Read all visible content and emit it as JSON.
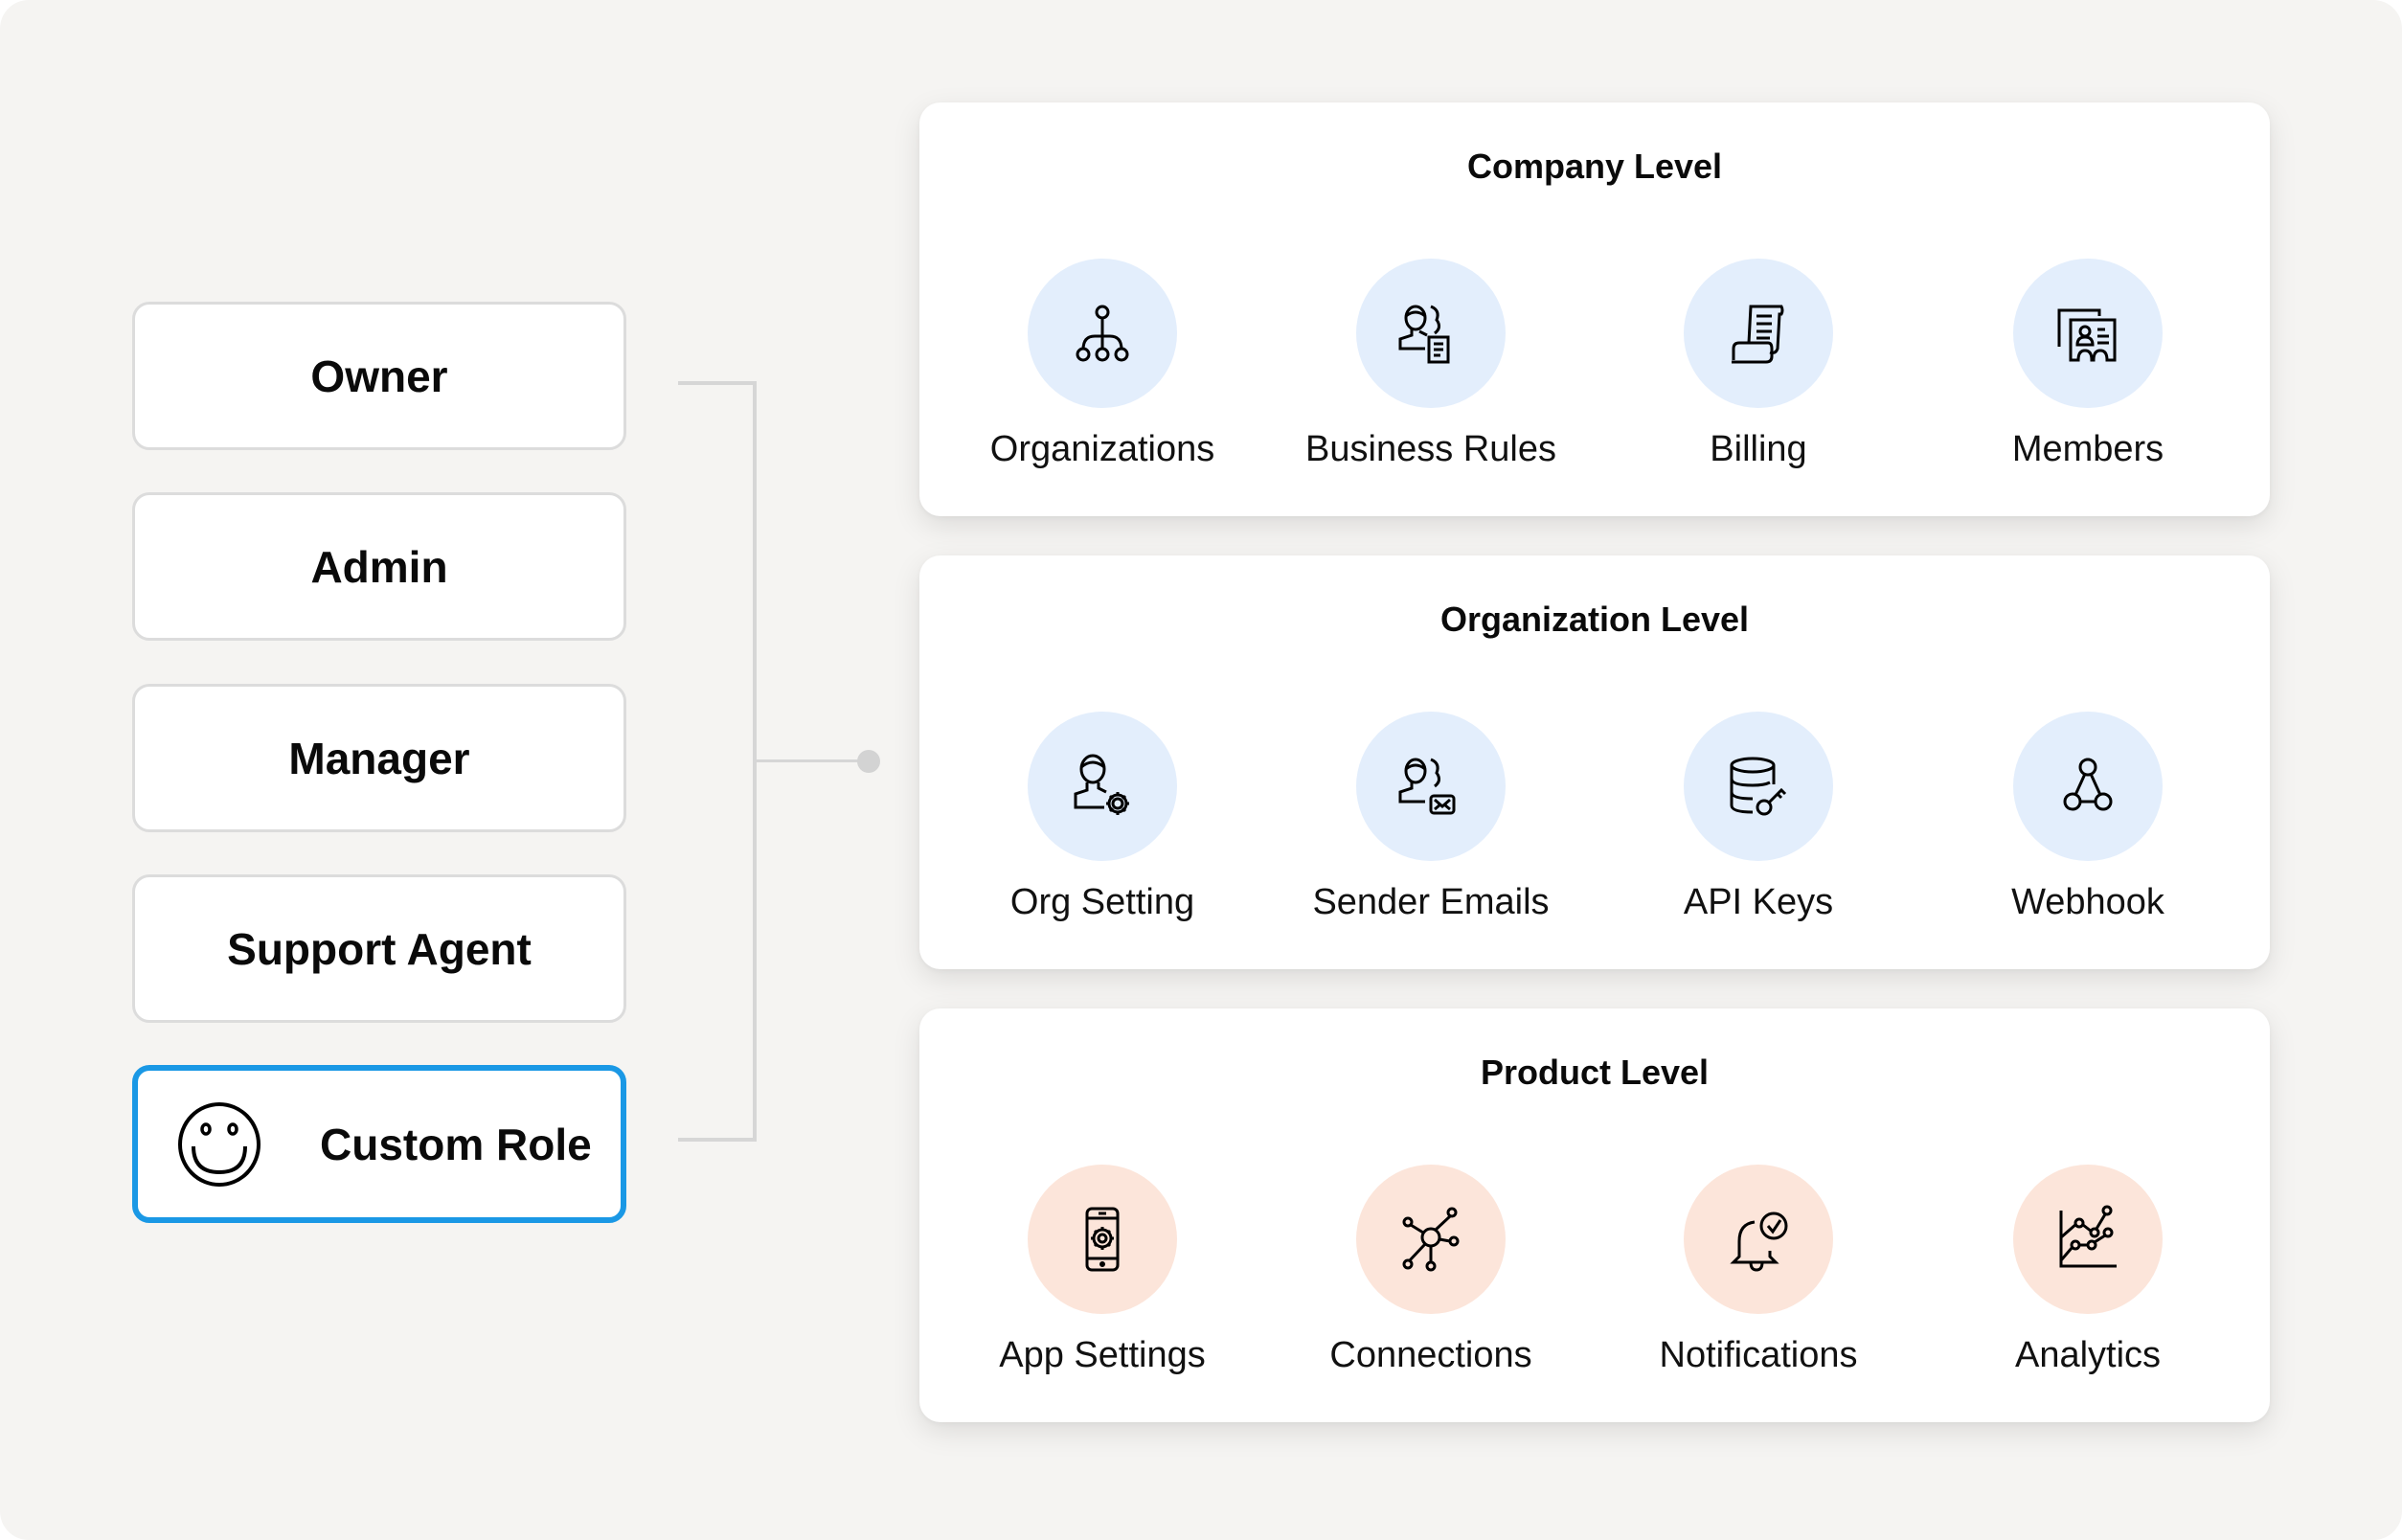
{
  "colors": {
    "background": "#f5f4f2",
    "selected_border": "#1a98e5",
    "company_icon_bg": "#e3eefc",
    "organization_icon_bg": "#e3eefc",
    "product_icon_bg": "#fce5da",
    "connector": "#d6d6d6"
  },
  "roles": [
    {
      "label": "Owner"
    },
    {
      "label": "Admin"
    },
    {
      "label": "Manager"
    },
    {
      "label": "Support Agent"
    },
    {
      "label": "Custom Role",
      "icon": "smiley-icon",
      "selected": true
    }
  ],
  "levels": [
    {
      "title": "Company Level",
      "items": [
        {
          "label": "Organizations",
          "icon": "hierarchy-icon"
        },
        {
          "label": "Business Rules",
          "icon": "user-document-icon"
        },
        {
          "label": "Billing",
          "icon": "receipt-scroll-icon"
        },
        {
          "label": "Members",
          "icon": "id-cards-icon"
        }
      ]
    },
    {
      "title": "Organization Level",
      "items": [
        {
          "label": "Org Setting",
          "icon": "user-gear-icon"
        },
        {
          "label": "Sender Emails",
          "icon": "user-mail-icon"
        },
        {
          "label": "API Keys",
          "icon": "database-key-icon"
        },
        {
          "label": "Webhook",
          "icon": "webhook-icon"
        }
      ]
    },
    {
      "title": "Product Level",
      "items": [
        {
          "label": "App Settings",
          "icon": "phone-gear-icon"
        },
        {
          "label": "Connections",
          "icon": "network-hub-icon"
        },
        {
          "label": "Notifications",
          "icon": "bell-check-icon"
        },
        {
          "label": "Analytics",
          "icon": "line-chart-icon"
        }
      ]
    }
  ]
}
